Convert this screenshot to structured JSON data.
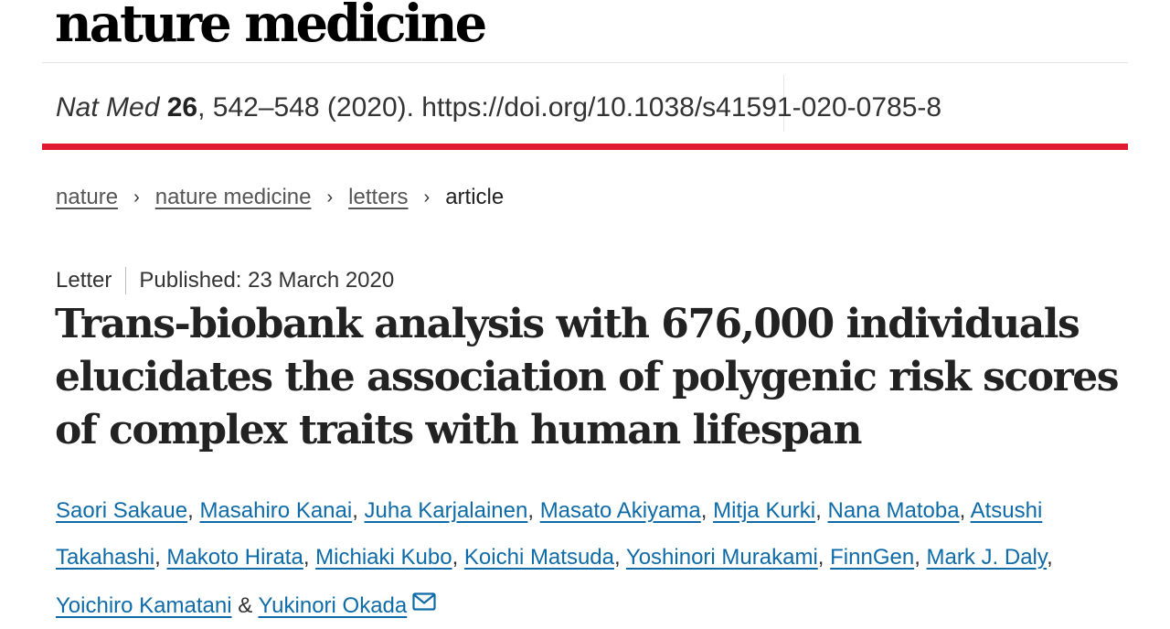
{
  "journal_logo": "nature medicine",
  "citation": {
    "journal": "Nat Med",
    "volume": "26",
    "rest": ", 542–548 (2020). https://doi.org/10.1038/s41591-020-0785-8"
  },
  "breadcrumb": {
    "items": [
      "nature",
      "nature medicine",
      "letters"
    ],
    "separator": "›",
    "current": "article"
  },
  "article": {
    "type": "Letter",
    "published": "Published: 23 March 2020",
    "title": "Trans-biobank analysis with 676,000 individuals elucidates the association of polygenic risk scores of complex traits with human lifespan"
  },
  "authors": {
    "names": [
      "Saori Sakaue",
      "Masahiro Kanai",
      "Juha Karjalainen",
      "Masato Akiyama",
      "Mitja Kurki",
      "Nana Matoba",
      "Atsushi Takahashi",
      "Makoto Hirata",
      "Michiaki Kubo",
      "Koichi Matsuda",
      "Yoshinori Murakami",
      "FinnGen",
      "Mark J. Daly",
      "Yoichiro Kamatani",
      "Yukinori Okada"
    ],
    "conjunction": "&",
    "corresponding_icon": "mail-icon"
  },
  "colors": {
    "accent_red": "#e01b2f",
    "link_blue": "#0e6ba8"
  }
}
